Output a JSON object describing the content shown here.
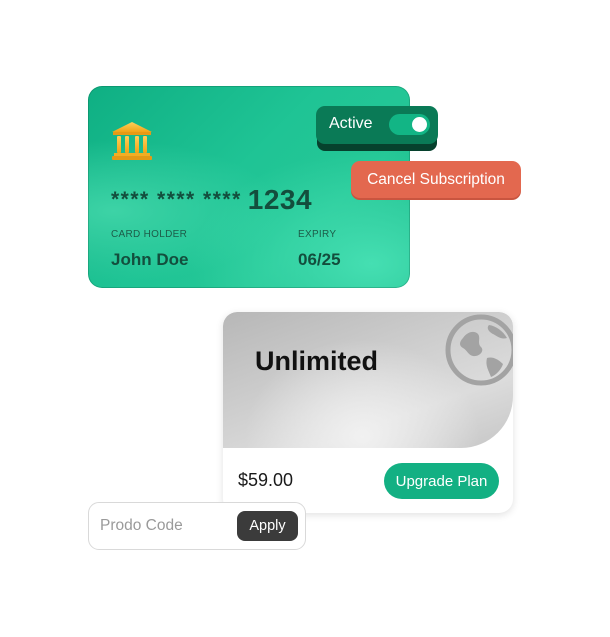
{
  "card": {
    "icon": "bank-icon",
    "number_masked": "**** **** ****",
    "number_last4": "1234",
    "holder_label": "CARD HOLDER",
    "holder_name": "John Doe",
    "expiry_label": "EXPIRY",
    "expiry_value": "06/25",
    "colors": {
      "background": "#1fc495",
      "text": "#134e3d"
    }
  },
  "status": {
    "label": "Active",
    "toggle_on": true,
    "colors": {
      "pill": "#0a7a56",
      "toggle": "#12b585"
    }
  },
  "cancel_button": {
    "label": "Cancel Subscription",
    "color": "#e3684f"
  },
  "plan": {
    "name": "Unlimited",
    "icon": "globe-icon",
    "price": "$59.00",
    "upgrade_label": "Upgrade Plan",
    "accent": "#13b083"
  },
  "promo": {
    "placeholder": "Prodo Code",
    "value": "",
    "apply_label": "Apply"
  }
}
